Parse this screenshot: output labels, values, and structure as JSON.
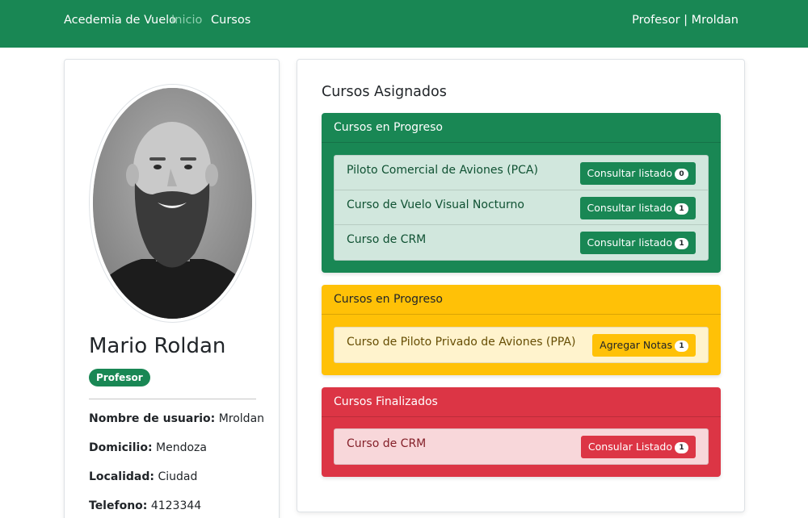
{
  "navbar": {
    "brand": "Acedemia de Vuelo",
    "links": [
      "Inicio",
      "Cursos"
    ],
    "user": "Profesor | Mroldan"
  },
  "profile": {
    "name": "Mario Roldan",
    "role": "Profesor",
    "fields": [
      {
        "label": "Nombre de usuario:",
        "value": "Mroldan"
      },
      {
        "label": "Domicilio:",
        "value": "Mendoza"
      },
      {
        "label": "Localidad:",
        "value": "Ciudad"
      },
      {
        "label": "Telefono:",
        "value": "4123344"
      }
    ]
  },
  "courses": {
    "title": "Cursos Asignados",
    "sections": [
      {
        "header": "Cursos en Progreso",
        "color": "#198754",
        "items": [
          {
            "name": "Piloto Comercial de Aviones (PCA)",
            "button": "Consultar listado",
            "count": "0"
          },
          {
            "name": "Curso de Vuelo Visual Nocturno",
            "button": "Consultar listado",
            "count": "1"
          },
          {
            "name": "Curso de CRM",
            "button": "Consultar listado",
            "count": "1"
          }
        ]
      },
      {
        "header": "Cursos en Progreso",
        "color": "#ffc107",
        "items": [
          {
            "name": "Curso de Piloto Privado de Aviones (PPA)",
            "button": "Agregar Notas",
            "count": "1"
          }
        ]
      },
      {
        "header": "Cursos Finalizados",
        "color": "#dc3545",
        "items": [
          {
            "name": "Curso de CRM",
            "button": "Consular Listado",
            "count": "1"
          }
        ]
      }
    ]
  }
}
